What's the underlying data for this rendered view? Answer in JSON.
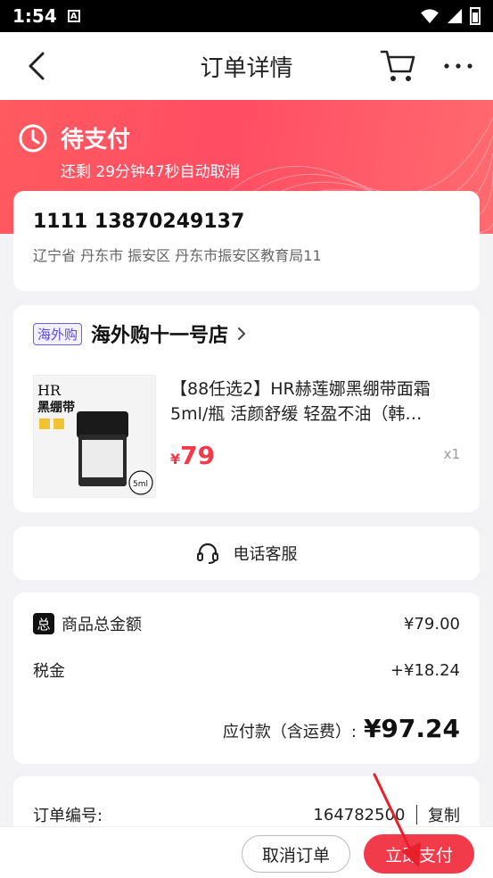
{
  "status_bar": {
    "time": "1:54",
    "notif": "A"
  },
  "nav": {
    "title": "订单详情"
  },
  "banner": {
    "status": "待支付",
    "countdown": "还剩 29分钟47秒自动取消"
  },
  "address": {
    "name_phone": "1111 13870249137",
    "detail": "辽宁省 丹东市 振安区 丹东市振安区教育局11"
  },
  "shop": {
    "badge": "海外购",
    "name": "海外购十一号店"
  },
  "product": {
    "title": "【88任选2】HR赫莲娜黑绷带面霜5ml/瓶 活颜舒缓 轻盈不油（韩…",
    "price_symbol": "¥",
    "price": "79",
    "qty": "x1",
    "img_brand": "HR",
    "img_text": "黑绷带",
    "img_size": "5ml"
  },
  "service": {
    "label": "电话客服"
  },
  "summary": {
    "total_icon": "总",
    "total_label": "商品总金额",
    "total_value": "¥79.00",
    "tax_label": "税金",
    "tax_value": "+¥18.24",
    "pay_label": "应付款（含运费）:",
    "pay_value": "¥97.24"
  },
  "order": {
    "label": "订单编号:",
    "number": "164782500",
    "copy": "复制"
  },
  "actions": {
    "cancel": "取消订单",
    "pay": "立即支付"
  },
  "colors": {
    "accent": "#f23b4a",
    "badge": "#5b4be6"
  }
}
